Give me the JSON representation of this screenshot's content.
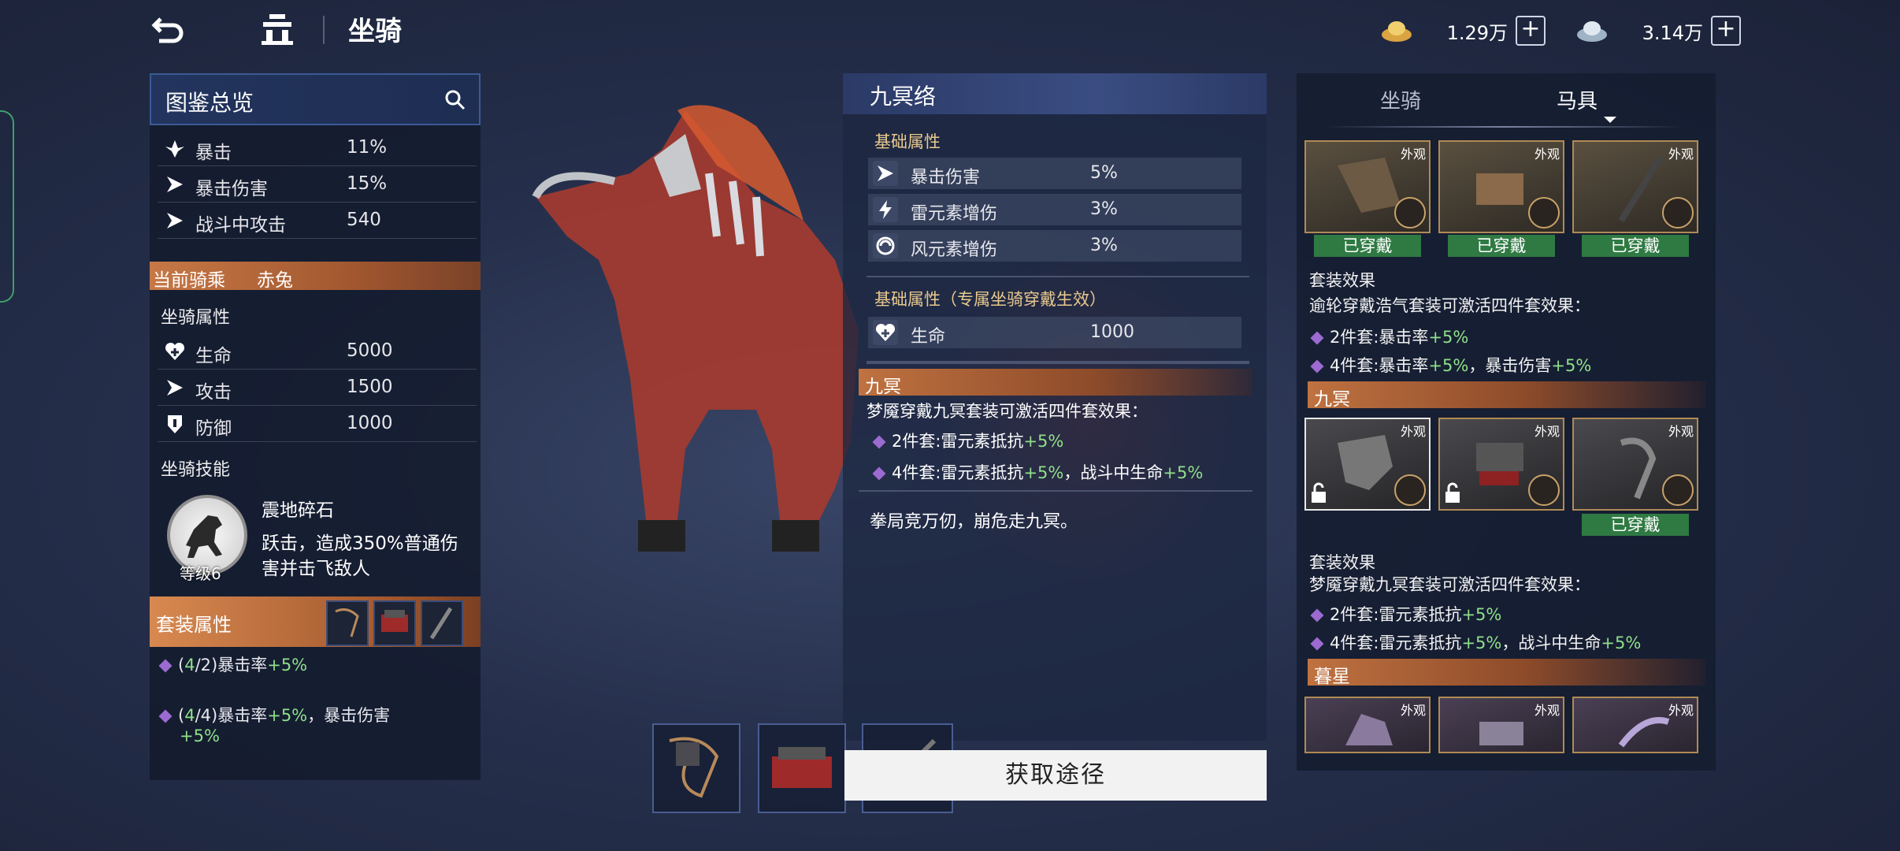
{
  "topbar": {
    "title": "坐骑"
  },
  "currencies": [
    {
      "icon": "gold-ingot-icon",
      "amount": "1.29万"
    },
    {
      "icon": "silver-ingot-icon",
      "amount": "3.14万"
    }
  ],
  "left": {
    "header": "图鉴总览",
    "overview": [
      {
        "icon": "crit-icon",
        "name": "暴击",
        "value": "11%"
      },
      {
        "icon": "crit-damage-icon",
        "name": "暴击伤害",
        "value": "15%"
      },
      {
        "icon": "combat-attack-icon",
        "name": "战斗中攻击",
        "value": "540"
      }
    ],
    "current_label": "当前骑乘",
    "current_name": "赤兔",
    "mount_attr_title": "坐骑属性",
    "mount_attrs": [
      {
        "icon": "health-icon",
        "name": "生命",
        "value": "5000"
      },
      {
        "icon": "attack-icon",
        "name": "攻击",
        "value": "1500"
      },
      {
        "icon": "defense-icon",
        "name": "防御",
        "value": "1000"
      }
    ],
    "skill_title": "坐骑技能",
    "skill": {
      "name": "震地碎石",
      "desc1": "跃击，造成350%普通伤",
      "desc2": "害并击飞敌人",
      "level": "等级6"
    },
    "set_title": "套装属性",
    "set_bonuses": [
      {
        "prefix": "(",
        "count": "4",
        "rest": "/2)暴击率",
        "bonus": "+5%",
        "extra": "",
        "extra2": ""
      },
      {
        "prefix": "(",
        "count": "4",
        "rest": "/4)暴击率",
        "bonus": "+5%",
        "extra": "，暴击伤害",
        "extra2": "+5%"
      }
    ]
  },
  "center": {
    "title": "九冥络",
    "basic_title": "基础属性",
    "basic": [
      {
        "icon": "crit-damage-icon",
        "name": "暴击伤害",
        "value": "5%"
      },
      {
        "icon": "lightning-icon",
        "name": "雷元素增伤",
        "value": "3%"
      },
      {
        "icon": "wind-icon",
        "name": "风元素增伤",
        "value": "3%"
      }
    ],
    "exclusive_title": "基础属性（专属坐骑穿戴生效）",
    "exclusive": [
      {
        "icon": "health-icon",
        "name": "生命",
        "value": "1000"
      }
    ],
    "set_name": "九冥",
    "set_desc": "梦魇穿戴九冥套装可激活四件套效果：",
    "set2_label": "2件套:雷元素抵抗",
    "set2_bonus": "+5%",
    "set4_label": "4件套:雷元素抵抗",
    "set4_bonus": "+5%",
    "set4_mid": "，战斗中生命",
    "set4_bonus2": "+5%",
    "flavor": "拳局竞万仞，崩危走九冥。",
    "acquire_label": "获取途径"
  },
  "right": {
    "tabs": [
      "坐骑",
      "马具"
    ],
    "active_tab": "马具",
    "appearance_tag": "外观",
    "worn_label": "已穿戴",
    "set1": {
      "effect_title": "套装效果",
      "desc": "逾轮穿戴浩气套装可激活四件套效果：",
      "b2_label": "2件套:暴击率",
      "b2_bonus": "+5%",
      "b4_label": "4件套:暴击率",
      "b4_bonus": "+5%",
      "b4_mid": "，暴击伤害",
      "b4_bonus2": "+5%"
    },
    "set2": {
      "name": "九冥",
      "effect_title": "套装效果",
      "desc": "梦魇穿戴九冥套装可激活四件套效果：",
      "b2_label": "2件套:雷元素抵抗",
      "b2_bonus": "+5%",
      "b4_label": "4件套:雷元素抵抗",
      "b4_bonus": "+5%",
      "b4_mid": "，战斗中生命",
      "b4_bonus2": "+5%"
    },
    "set3": {
      "name": "暮星"
    }
  }
}
